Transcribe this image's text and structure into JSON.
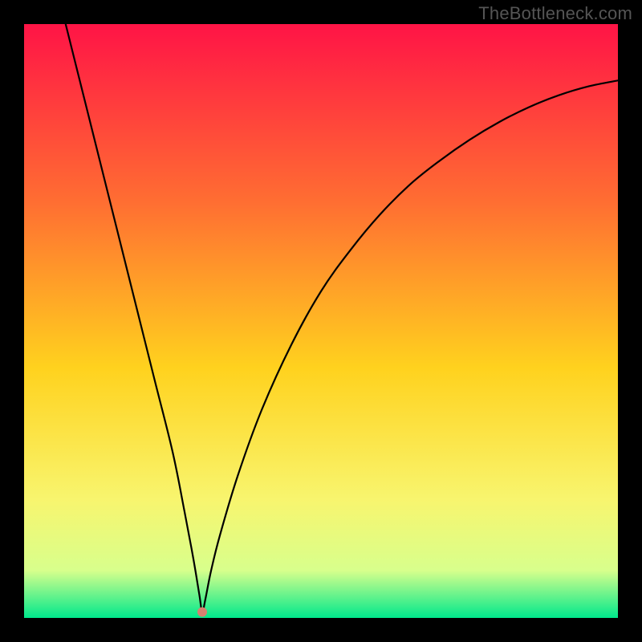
{
  "watermark": {
    "text": "TheBottleneck.com"
  },
  "colors": {
    "background": "#000000",
    "gradient_top": "#ff1446",
    "gradient_mid_upper": "#ff6e32",
    "gradient_mid": "#ffd21e",
    "gradient_mid_lower": "#f8f56e",
    "gradient_lower": "#d8ff8c",
    "gradient_bottom": "#00e88c",
    "curve": "#000000",
    "marker": "#d88070"
  },
  "chart_data": {
    "type": "line",
    "title": "",
    "xlabel": "",
    "ylabel": "",
    "xlim": [
      0,
      100
    ],
    "ylim": [
      0,
      100
    ],
    "grid": false,
    "legend": false,
    "series": [
      {
        "name": "bottleneck-curve",
        "x": [
          7,
          10,
          13,
          16,
          19,
          22,
          25,
          27,
          28.5,
          29.5,
          30,
          30.5,
          31.5,
          33,
          36,
          40,
          45,
          50,
          55,
          60,
          65,
          70,
          75,
          80,
          85,
          90,
          95,
          100
        ],
        "y": [
          100,
          88,
          76,
          64,
          52,
          40,
          28,
          18,
          10,
          4,
          1,
          3,
          8,
          14,
          24,
          35,
          46,
          55,
          62,
          68,
          73,
          77,
          80.5,
          83.5,
          86,
          88,
          89.5,
          90.5
        ]
      }
    ],
    "marker": {
      "x": 30,
      "y": 1,
      "radius_px": 6
    }
  }
}
